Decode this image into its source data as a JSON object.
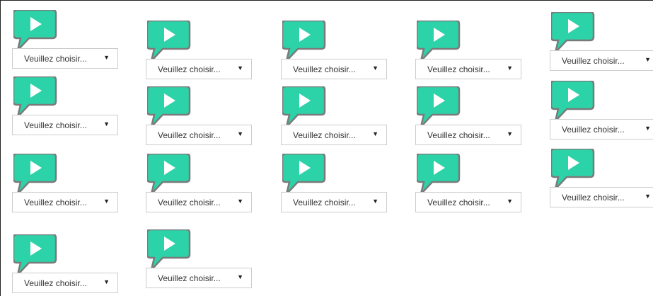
{
  "icons": {
    "media": "speech-bubble-play-icon",
    "dropdown": "caret-down-icon"
  },
  "colors": {
    "bubble_fill": "#2cd3a8",
    "bubble_border": "#7a7a7a",
    "triangle": "#ffffff"
  },
  "items": [
    {
      "select": {
        "value": "Veuillez choisir...",
        "arrow": "▼"
      }
    },
    {
      "select": {
        "value": "Veuillez choisir...",
        "arrow": "▼"
      }
    },
    {
      "select": {
        "value": "Veuillez choisir...",
        "arrow": "▼"
      }
    },
    {
      "select": {
        "value": "Veuillez choisir...",
        "arrow": "▼"
      }
    },
    {
      "select": {
        "value": "Veuillez choisir...",
        "arrow": "▼"
      }
    },
    {
      "select": {
        "value": "Veuillez choisir...",
        "arrow": "▼"
      }
    },
    {
      "select": {
        "value": "Veuillez choisir...",
        "arrow": "▼"
      }
    },
    {
      "select": {
        "value": "Veuillez choisir...",
        "arrow": "▼"
      }
    },
    {
      "select": {
        "value": "Veuillez choisir...",
        "arrow": "▼"
      }
    },
    {
      "select": {
        "value": "Veuillez choisir...",
        "arrow": "▼"
      }
    },
    {
      "select": {
        "value": "Veuillez choisir...",
        "arrow": "▼"
      }
    },
    {
      "select": {
        "value": "Veuillez choisir...",
        "arrow": "▼"
      }
    },
    {
      "select": {
        "value": "Veuillez choisir...",
        "arrow": "▼"
      }
    },
    {
      "select": {
        "value": "Veuillez choisir...",
        "arrow": "▼"
      }
    },
    {
      "select": {
        "value": "Veuillez choisir...",
        "arrow": "▼"
      }
    },
    {
      "select": {
        "value": "Veuillez choisir...",
        "arrow": "▼"
      }
    },
    {
      "select": {
        "value": "Veuillez choisir...",
        "arrow": "▼"
      }
    }
  ]
}
